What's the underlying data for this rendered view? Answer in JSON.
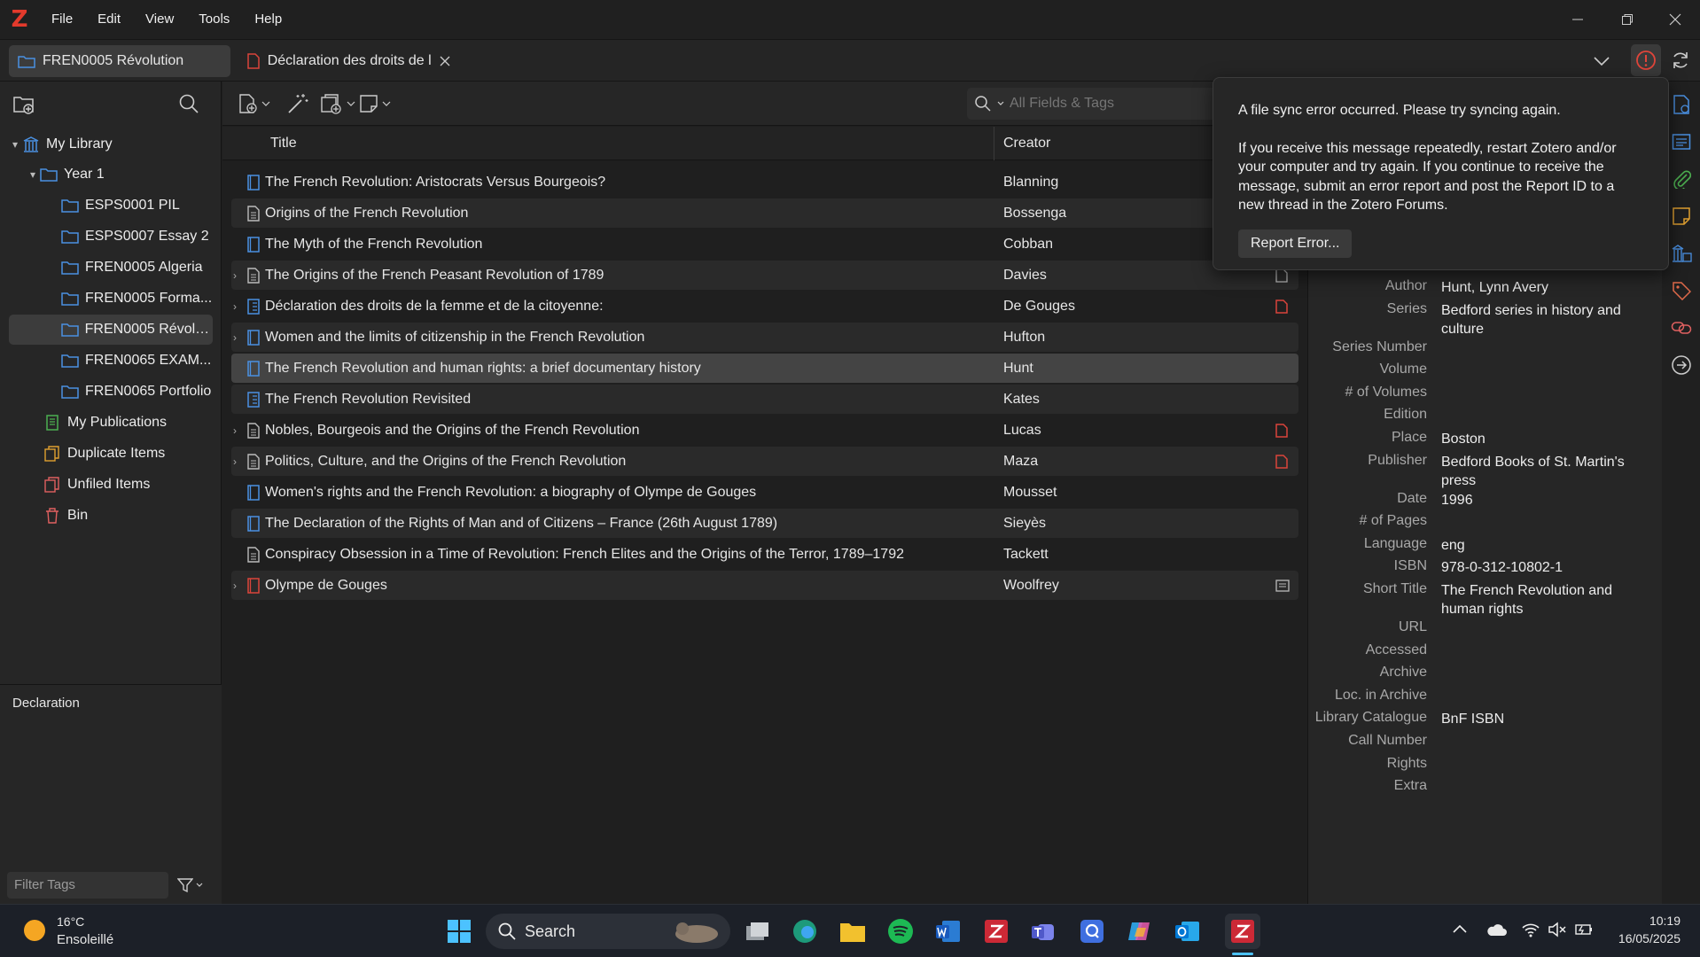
{
  "app": {
    "logo": "Z",
    "menu": [
      "File",
      "Edit",
      "View",
      "Tools",
      "Help"
    ]
  },
  "tabs": [
    {
      "label": "FREN0005 Révolution",
      "icon": "folder-icon"
    },
    {
      "label": "Déclaration des droits de l",
      "icon": "pdf-icon"
    }
  ],
  "collections": {
    "my_library": "My Library",
    "year1": "Year 1",
    "items": [
      "ESPS0001 PIL",
      "ESPS0007 Essay 2",
      "FREN0005 Algeria",
      "FREN0005 Forma...",
      "FREN0005 Révolu...",
      "FREN0065 EXAM...",
      "FREN0065 Portfolio"
    ],
    "my_publications": "My Publications",
    "duplicate_items": "Duplicate Items",
    "unfiled_items": "Unfiled Items",
    "bin": "Bin"
  },
  "tags": {
    "tag_label": "Declaration",
    "filter_placeholder": "Filter Tags"
  },
  "search": {
    "placeholder": "All Fields & Tags"
  },
  "columns": {
    "title": "Title",
    "creator": "Creator"
  },
  "items": [
    {
      "title": "The French Revolution: Aristocrats Versus Bourgeois?",
      "creator": "Blanning",
      "type": "book",
      "expandable": false,
      "attachment": ""
    },
    {
      "title": "Origins of the French Revolution",
      "creator": "Bossenga",
      "type": "document",
      "expandable": false,
      "attachment": ""
    },
    {
      "title": "The Myth of the French Revolution",
      "creator": "Cobban",
      "type": "book",
      "expandable": false,
      "attachment": ""
    },
    {
      "title": "The Origins of the French Peasant Revolution of 1789",
      "creator": "Davies",
      "type": "document",
      "expandable": true,
      "attachment": "blank"
    },
    {
      "title": "Déclaration des droits de la femme et de la citoyenne:",
      "creator": "De Gouges",
      "type": "book-section",
      "expandable": true,
      "attachment": "pdf"
    },
    {
      "title": "Women and the limits of citizenship in the French Revolution",
      "creator": "Hufton",
      "type": "book",
      "expandable": true,
      "attachment": ""
    },
    {
      "title": "The French Revolution and human rights: a brief documentary history",
      "creator": "Hunt",
      "type": "book",
      "expandable": false,
      "attachment": ""
    },
    {
      "title": "The French Revolution Revisited",
      "creator": "Kates",
      "type": "book-section",
      "expandable": false,
      "attachment": ""
    },
    {
      "title": "Nobles, Bourgeois and the Origins of the French Revolution",
      "creator": "Lucas",
      "type": "document",
      "expandable": true,
      "attachment": "pdf"
    },
    {
      "title": "Politics, Culture, and the Origins of the French Revolution",
      "creator": "Maza",
      "type": "document",
      "expandable": true,
      "attachment": "pdf"
    },
    {
      "title": "Women's rights and the French Revolution: a biography of Olympe de Gouges",
      "creator": "Mousset",
      "type": "book",
      "expandable": false,
      "attachment": ""
    },
    {
      "title": "The Declaration of the Rights of Man and of Citizens – France (26th August 1789)",
      "creator": "Sieyès",
      "type": "book",
      "expandable": false,
      "attachment": ""
    },
    {
      "title": "Conspiracy Obsession in a Time of Revolution: French Elites and the Origins of the Terror, 1789–1792",
      "creator": "Tackett",
      "type": "document",
      "expandable": false,
      "attachment": ""
    },
    {
      "title": "Olympe de Gouges",
      "creator": "Woolfrey",
      "type": "book-red",
      "expandable": true,
      "attachment": "snapshot"
    }
  ],
  "info_fields": [
    {
      "label": "Author",
      "value": "Hunt, Lynn Avery"
    },
    {
      "label": "Series",
      "value": "Bedford series in history and culture"
    },
    {
      "label": "Series Number",
      "value": ""
    },
    {
      "label": "Volume",
      "value": ""
    },
    {
      "label": "# of Volumes",
      "value": ""
    },
    {
      "label": "Edition",
      "value": ""
    },
    {
      "label": "Place",
      "value": "Boston"
    },
    {
      "label": "Publisher",
      "value": "Bedford Books of St. Martin's press"
    },
    {
      "label": "Date",
      "value": "1996"
    },
    {
      "label": "# of Pages",
      "value": ""
    },
    {
      "label": "Language",
      "value": "eng"
    },
    {
      "label": "ISBN",
      "value": "978-0-312-10802-1"
    },
    {
      "label": "Short Title",
      "value": "The French Revolution and human rights"
    },
    {
      "label": "URL",
      "value": ""
    },
    {
      "label": "Accessed",
      "value": ""
    },
    {
      "label": "Archive",
      "value": ""
    },
    {
      "label": "Loc. in Archive",
      "value": ""
    },
    {
      "label": "Library Catalogue",
      "value": "BnF ISBN"
    },
    {
      "label": "Call Number",
      "value": ""
    },
    {
      "label": "Rights",
      "value": ""
    },
    {
      "label": "Extra",
      "value": ""
    }
  ],
  "sync_popup": {
    "message1": "A file sync error occurred. Please try syncing again.",
    "message2": "If you receive this message repeatedly, restart Zotero and/or your computer and try again. If you continue to receive the message, submit an error report and post the Report ID to a new thread in the Zotero Forums.",
    "button": "Report Error..."
  },
  "taskbar": {
    "weather_temp": "16°C",
    "weather_desc": "Ensoleillé",
    "search_label": "Search",
    "time": "10:19",
    "date": "16/05/2025"
  },
  "colors": {
    "accent": "#3b82f6",
    "zotero_red": "#e33a2c",
    "pdf_red": "#d9443b"
  }
}
